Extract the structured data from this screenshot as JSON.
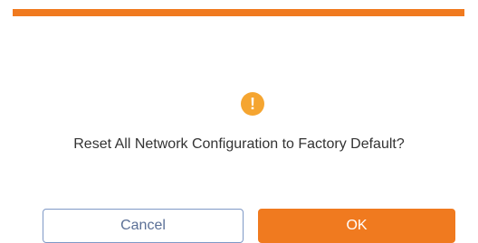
{
  "dialog": {
    "accent_color": "#f07a1f",
    "icon": {
      "name": "exclamation-icon",
      "glyph": "!",
      "color": "#f5a531"
    },
    "message": "Reset All Network Configuration to Factory Default?",
    "buttons": {
      "cancel_label": "Cancel",
      "ok_label": "OK"
    }
  }
}
